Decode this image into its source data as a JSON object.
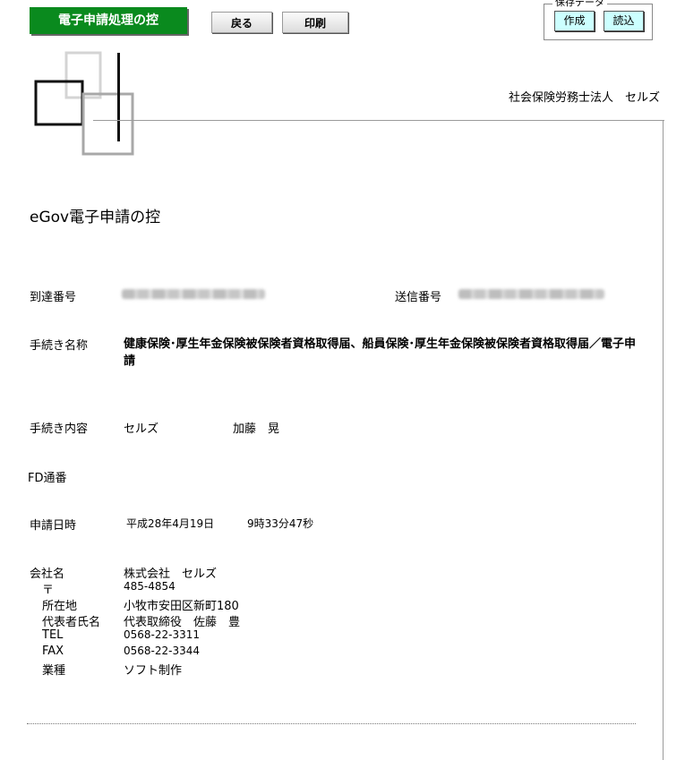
{
  "toolbar": {
    "title": "電子申請処理の控",
    "back_label": "戻る",
    "print_label": "印刷",
    "save_data": {
      "legend": "保存データ",
      "create_label": "作成",
      "load_label": "読込"
    }
  },
  "header": {
    "corporation": "社会保険労務士法人　セルズ"
  },
  "document": {
    "title": "eGov電子申請の控",
    "arrival_number_label": "到達番号",
    "send_number_label": "送信番号",
    "procedure_name_label": "手続き名称",
    "procedure_name": "健康保険･厚生年金保険被保険者資格取得届、船員保険･厚生年金保険被保険者資格取得届／電子申請",
    "procedure_content_label": "手続き内容",
    "procedure_content_company": "セルズ",
    "procedure_content_person": "加藤　晃",
    "fd_serial_label": "FD通番",
    "application_datetime_label": "申請日時",
    "application_date": "平成28年4月19日",
    "application_time": "9時33分47秒"
  },
  "company": {
    "name_label": "会社名",
    "name": "株式会社　セルズ",
    "postal_label": "〒",
    "postal": "485-4854",
    "address_label": "所在地",
    "address": "小牧市安田区新町180",
    "rep_label": "代表者氏名",
    "rep": "代表取締役　佐藤　豊",
    "tel_label": "TEL",
    "tel": "0568-22-3311",
    "fax_label": "FAX",
    "fax": "0568-22-3344",
    "industry_label": "業種",
    "industry": "ソフト制作"
  }
}
